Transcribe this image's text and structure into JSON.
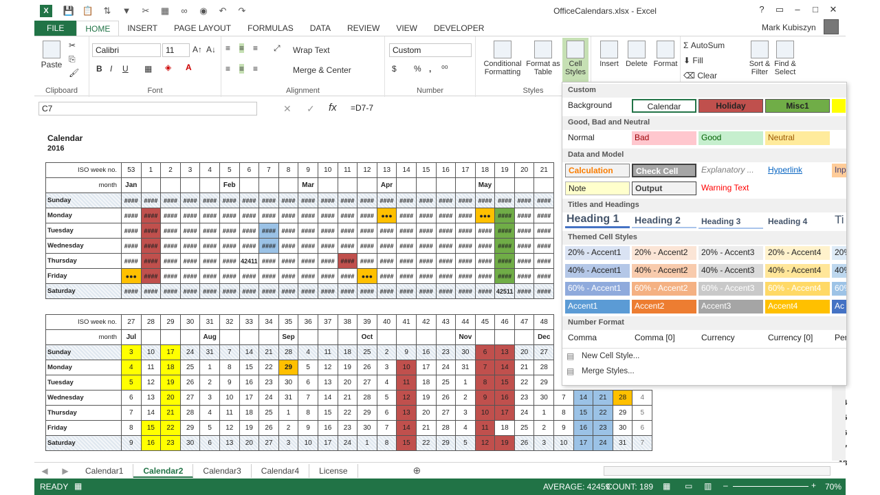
{
  "window": {
    "title": "OfficeCalendars.xlsx - Excel",
    "user": "Mark Kubiszyn"
  },
  "ribbon_tabs": [
    "FILE",
    "HOME",
    "INSERT",
    "PAGE LAYOUT",
    "FORMULAS",
    "DATA",
    "REVIEW",
    "VIEW",
    "DEVELOPER"
  ],
  "clipboard": {
    "paste": "Paste",
    "label": "Clipboard"
  },
  "font": {
    "name": "Calibri",
    "size": "11",
    "label": "Font",
    "bold": "B",
    "italic": "I",
    "underline": "U"
  },
  "alignment": {
    "wrap": "Wrap Text",
    "merge": "Merge & Center",
    "label": "Alignment"
  },
  "number": {
    "format": "Custom",
    "label": "Number",
    "percent": "%",
    "comma": ","
  },
  "styles": {
    "cond": "Conditional Formatting",
    "format_table": "Format as Table",
    "cell_styles": "Cell Styles",
    "label": "Styles"
  },
  "cells": {
    "insert": "Insert",
    "delete": "Delete",
    "format": "Format"
  },
  "editing": {
    "autosum": "AutoSum",
    "fill": "Fill",
    "clear": "Clear",
    "sort": "Sort & Filter",
    "find": "Find & Select"
  },
  "formula_bar": {
    "name_box": "C7",
    "formula": "=D7-7",
    "fx": "fx"
  },
  "sheet": {
    "title": "Calendar",
    "year": "2016"
  },
  "table1": {
    "weeks": [
      "53",
      "1",
      "2",
      "3",
      "4",
      "5",
      "6",
      "7",
      "8",
      "9",
      "10",
      "11",
      "12",
      "13",
      "14",
      "15",
      "16",
      "17",
      "18",
      "19",
      "20",
      "21"
    ],
    "months": [
      "Jan",
      "",
      "",
      "",
      "",
      "Feb",
      "",
      "",
      "",
      "Mar",
      "",
      "",
      "",
      "Apr",
      "",
      "",
      "",
      "",
      "May",
      "",
      "",
      ""
    ],
    "days": [
      "Sunday",
      "Monday",
      "Tuesday",
      "Wednesday",
      "Thursday",
      "Friday",
      "Saturday"
    ],
    "week_label": "ISO week no.",
    "month_label": "month",
    "mask": "####",
    "dots": "●●●",
    "val_thu": "42411",
    "val_sat": "42511"
  },
  "table2": {
    "weeks": [
      "27",
      "28",
      "29",
      "30",
      "31",
      "32",
      "33",
      "34",
      "35",
      "36",
      "37",
      "38",
      "39",
      "40",
      "41",
      "42",
      "43",
      "44",
      "45",
      "46",
      "47",
      "48",
      "",
      "",
      "",
      ""
    ],
    "months": [
      "Jul",
      "",
      "",
      "",
      "Aug",
      "",
      "",
      "",
      "Sep",
      "",
      "",
      "",
      "Oct",
      "",
      "",
      "",
      "",
      "Nov",
      "",
      "",
      "",
      "Dec",
      "",
      "",
      "",
      ""
    ],
    "rows": [
      [
        "3",
        "10",
        "17",
        "24",
        "31",
        "7",
        "14",
        "21",
        "28",
        "4",
        "11",
        "18",
        "25",
        "2",
        "9",
        "16",
        "23",
        "30",
        "6",
        "13",
        "20",
        "27",
        "",
        "",
        "",
        ""
      ],
      [
        "4",
        "11",
        "18",
        "25",
        "1",
        "8",
        "15",
        "22",
        "29",
        "5",
        "12",
        "19",
        "26",
        "3",
        "10",
        "17",
        "24",
        "31",
        "7",
        "14",
        "21",
        "28",
        "",
        "",
        "",
        ""
      ],
      [
        "5",
        "12",
        "19",
        "26",
        "2",
        "9",
        "16",
        "23",
        "30",
        "6",
        "13",
        "20",
        "27",
        "4",
        "11",
        "18",
        "25",
        "1",
        "8",
        "15",
        "22",
        "29",
        "",
        "",
        "",
        ""
      ],
      [
        "6",
        "13",
        "20",
        "27",
        "3",
        "10",
        "17",
        "24",
        "31",
        "7",
        "14",
        "21",
        "28",
        "5",
        "12",
        "19",
        "26",
        "2",
        "9",
        "16",
        "23",
        "30",
        "7",
        "14",
        "21",
        "28",
        "4"
      ],
      [
        "7",
        "14",
        "21",
        "28",
        "4",
        "11",
        "18",
        "25",
        "1",
        "8",
        "15",
        "22",
        "29",
        "6",
        "13",
        "20",
        "27",
        "3",
        "10",
        "17",
        "24",
        "1",
        "8",
        "15",
        "22",
        "29",
        "5"
      ],
      [
        "8",
        "15",
        "22",
        "29",
        "5",
        "12",
        "19",
        "26",
        "2",
        "9",
        "16",
        "23",
        "30",
        "7",
        "14",
        "21",
        "28",
        "4",
        "11",
        "18",
        "25",
        "2",
        "9",
        "16",
        "23",
        "30",
        "6"
      ],
      [
        "9",
        "16",
        "23",
        "30",
        "6",
        "13",
        "20",
        "27",
        "3",
        "10",
        "17",
        "24",
        "1",
        "8",
        "15",
        "22",
        "29",
        "5",
        "12",
        "19",
        "26",
        "3",
        "10",
        "17",
        "24",
        "31",
        "7"
      ]
    ]
  },
  "row_numbers": [
    "14",
    "15",
    "16",
    "17",
    "18"
  ],
  "cell_styles": {
    "custom": "Custom",
    "custom_items": [
      "Background",
      "Calendar",
      "Holiday",
      "Misc1"
    ],
    "good_bad": "Good, Bad and Neutral",
    "gbn_items": [
      "Normal",
      "Bad",
      "Good",
      "Neutral"
    ],
    "data_model": "Data and Model",
    "dm1": [
      "Calculation",
      "Check Cell",
      "Explanatory ...",
      "Hyperlink",
      "Inp"
    ],
    "dm2": [
      "Note",
      "Output",
      "Warning Text"
    ],
    "titles": "Titles and Headings",
    "headings": [
      "Heading 1",
      "Heading 2",
      "Heading 3",
      "Heading 4",
      "Ti"
    ],
    "themed": "Themed Cell Styles",
    "t20": [
      "20% - Accent1",
      "20% - Accent2",
      "20% - Accent3",
      "20% - Accent4",
      "20%"
    ],
    "t40": [
      "40% - Accent1",
      "40% - Accent2",
      "40% - Accent3",
      "40% - Accent4",
      "40%"
    ],
    "t60": [
      "60% - Accent1",
      "60% - Accent2",
      "60% - Accent3",
      "60% - Accent4",
      "60%"
    ],
    "acc": [
      "Accent1",
      "Accent2",
      "Accent3",
      "Accent4",
      "Ac"
    ],
    "numfmt": "Number Format",
    "nf": [
      "Comma",
      "Comma [0]",
      "Currency",
      "Currency [0]",
      "Per"
    ],
    "new_style": "New Cell Style...",
    "merge_styles": "Merge Styles..."
  },
  "sheet_tabs": [
    "Calendar1",
    "Calendar2",
    "Calendar3",
    "Calendar4",
    "License"
  ],
  "status": {
    "ready": "READY",
    "average": "AVERAGE: 42459",
    "count": "COUNT: 189",
    "zoom": "70%"
  },
  "colors": {
    "excel_green": "#217346",
    "holiday": "#c0504d",
    "misc1": "#70ad47",
    "yellow": "#ffff00",
    "orange": "#ffc000",
    "blue": "#9bc2e6"
  }
}
